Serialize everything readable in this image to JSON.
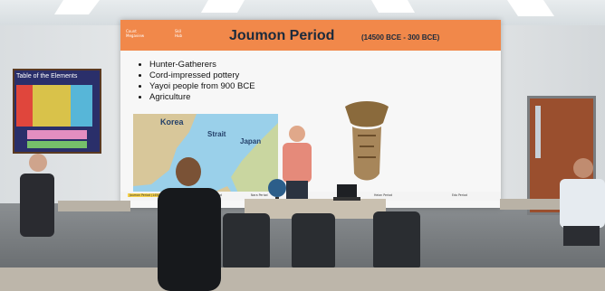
{
  "slide": {
    "header_left_line1": "Count",
    "header_left_line2": "Megaview",
    "header_left_line3": "Skil",
    "header_left_line4": "Hub",
    "title": "Joumon Period",
    "date_range": "(14500 BCE - 300 BCE)",
    "bullets": [
      "Hunter-Gatherers",
      "Cord-impressed pottery",
      "Yayoi people from 900 BCE",
      "Agriculture"
    ],
    "map_labels": {
      "korea": "Korea",
      "strait": "Strait",
      "japan": "Japan"
    },
    "timeline_items": [
      "Joumon Period (14500 BCE-300 BCE)",
      "Kofun Period",
      "Nara Period",
      "Heian Period",
      "Edo Period"
    ]
  },
  "classroom_poster": {
    "title": "Table of the Elements"
  },
  "colors": {
    "slide_header": "#f1884a",
    "title_text": "#1a2a3c",
    "map_water": "#9ad0ea",
    "map_land": "#d8c79a"
  }
}
